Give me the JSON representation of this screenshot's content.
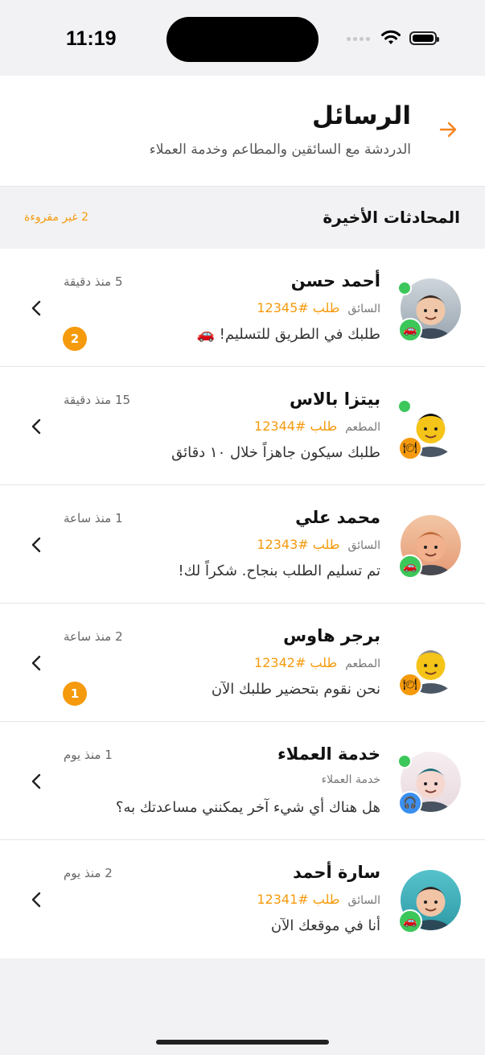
{
  "status_bar": {
    "time": "11:19"
  },
  "header": {
    "title": "الرسائل",
    "subtitle": "الدردشة مع السائقين والمطاعم وخدمة العملاء"
  },
  "section": {
    "title": "المحادثات الأخيرة",
    "unread_label": "2 غير مقروءة"
  },
  "colors": {
    "accent": "#f59a0c",
    "online": "#3cc75a",
    "driver_badge": "#3cc75a",
    "restaurant_badge": "#f59a0c",
    "support_badge": "#3b8ff0"
  },
  "conversations": [
    {
      "name": "أحمد حسن",
      "time": "5 منذ دقيقة",
      "role": "السائق",
      "order": "طلب #12345",
      "preview": "طلبك في الطريق للتسليم! 🚗",
      "unread": "2",
      "online": true,
      "badge_icon": "car-icon"
    },
    {
      "name": "بيتزا بالاس",
      "time": "15 منذ دقيقة",
      "role": "المطعم",
      "order": "طلب #12344",
      "preview": "طلبك سيكون جاهزاً خلال ١٠ دقائق",
      "unread": "",
      "online": true,
      "badge_icon": "restaurant-icon"
    },
    {
      "name": "محمد علي",
      "time": "1 منذ ساعة",
      "role": "السائق",
      "order": "طلب #12343",
      "preview": "تم تسليم الطلب بنجاح. شكراً لك!",
      "unread": "",
      "online": false,
      "badge_icon": "car-icon"
    },
    {
      "name": "برجر هاوس",
      "time": "2 منذ ساعة",
      "role": "المطعم",
      "order": "طلب #12342",
      "preview": "نحن نقوم بتحضير طلبك الآن",
      "unread": "1",
      "online": false,
      "badge_icon": "restaurant-icon"
    },
    {
      "name": "خدمة العملاء",
      "time": "1 منذ يوم",
      "role": "خدمة العملاء",
      "order": "",
      "preview": "هل هناك أي شيء آخر يمكنني مساعدتك به؟",
      "unread": "",
      "online": true,
      "badge_icon": "headset-icon"
    },
    {
      "name": "سارة أحمد",
      "time": "2 منذ يوم",
      "role": "السائق",
      "order": "طلب #12341",
      "preview": "أنا في موقعك الآن",
      "unread": "",
      "online": false,
      "badge_icon": "car-icon"
    }
  ]
}
